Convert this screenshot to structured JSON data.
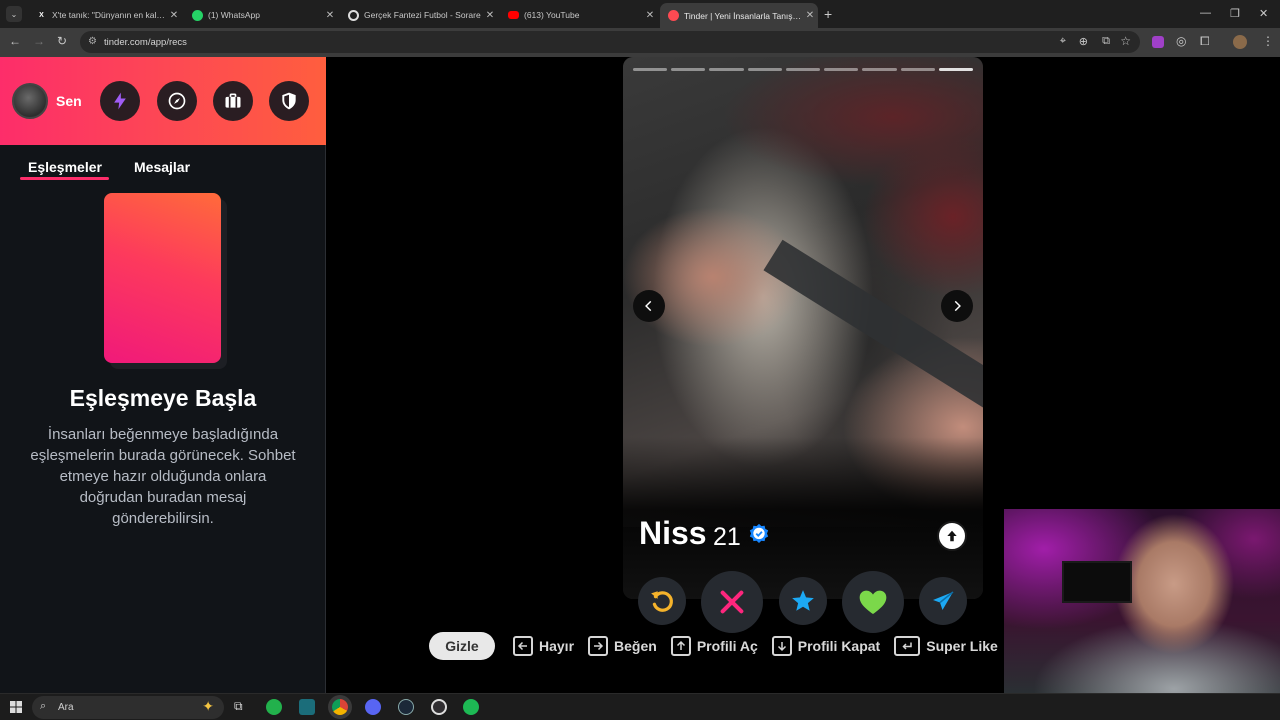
{
  "browser": {
    "tabs": [
      {
        "label": "X'te tanık: \"Dünyanın en kalın s",
        "icon": "x-logo-icon"
      },
      {
        "label": "(1) WhatsApp",
        "icon": "whatsapp-icon"
      },
      {
        "label": "Gerçek Fantezi Futbol - Sorare",
        "icon": "sorare-icon"
      },
      {
        "label": "(613) YouTube",
        "icon": "youtube-icon"
      },
      {
        "label": "Tinder | Yeni İnsanlarla Tanış, Bu",
        "icon": "tinder-icon",
        "active": true
      }
    ],
    "url": "tinder.com/app/recs"
  },
  "sidebar": {
    "self_label": "Sen",
    "tabs": [
      "Eşleşmeler",
      "Mesajlar"
    ],
    "active_tab": "Eşleşmeler",
    "empty_title": "Eşleşmeye Başla",
    "empty_description": "İnsanları beğenmeye başladığında eşleşmelerin burada görünecek. Sohbet etmeye hazır olduğunda onlara doğrudan buradan mesaj gönderebilirsin.",
    "header_icons": [
      "boost-icon",
      "explore-icon",
      "briefcase-icon",
      "shield-icon"
    ]
  },
  "profile": {
    "name": "Niss",
    "age": "21",
    "verified": true,
    "photo_count": 9,
    "photo_index": 9
  },
  "actions": [
    "rewind-icon",
    "nope-icon",
    "super-like-icon",
    "like-icon",
    "boost-send-icon"
  ],
  "shortcuts": {
    "hide": "Gizle",
    "items": [
      {
        "key": "arrow-left-icon",
        "label": "Hayır"
      },
      {
        "key": "arrow-right-icon",
        "label": "Beğen"
      },
      {
        "key": "arrow-up-icon",
        "label": "Profili Aç"
      },
      {
        "key": "arrow-down-icon",
        "label": "Profili Kapat"
      },
      {
        "key": "enter-key-icon",
        "label": "Super Like"
      }
    ]
  },
  "taskbar": {
    "search_placeholder": "Ara"
  },
  "colors": {
    "brand_gradient_start": "#fd2d6a",
    "brand_gradient_end": "#ff5e3e",
    "nope": "#fd267d",
    "like": "#7bd84a",
    "super_like": "#1ca9f4",
    "rewind": "#f5b32b"
  }
}
